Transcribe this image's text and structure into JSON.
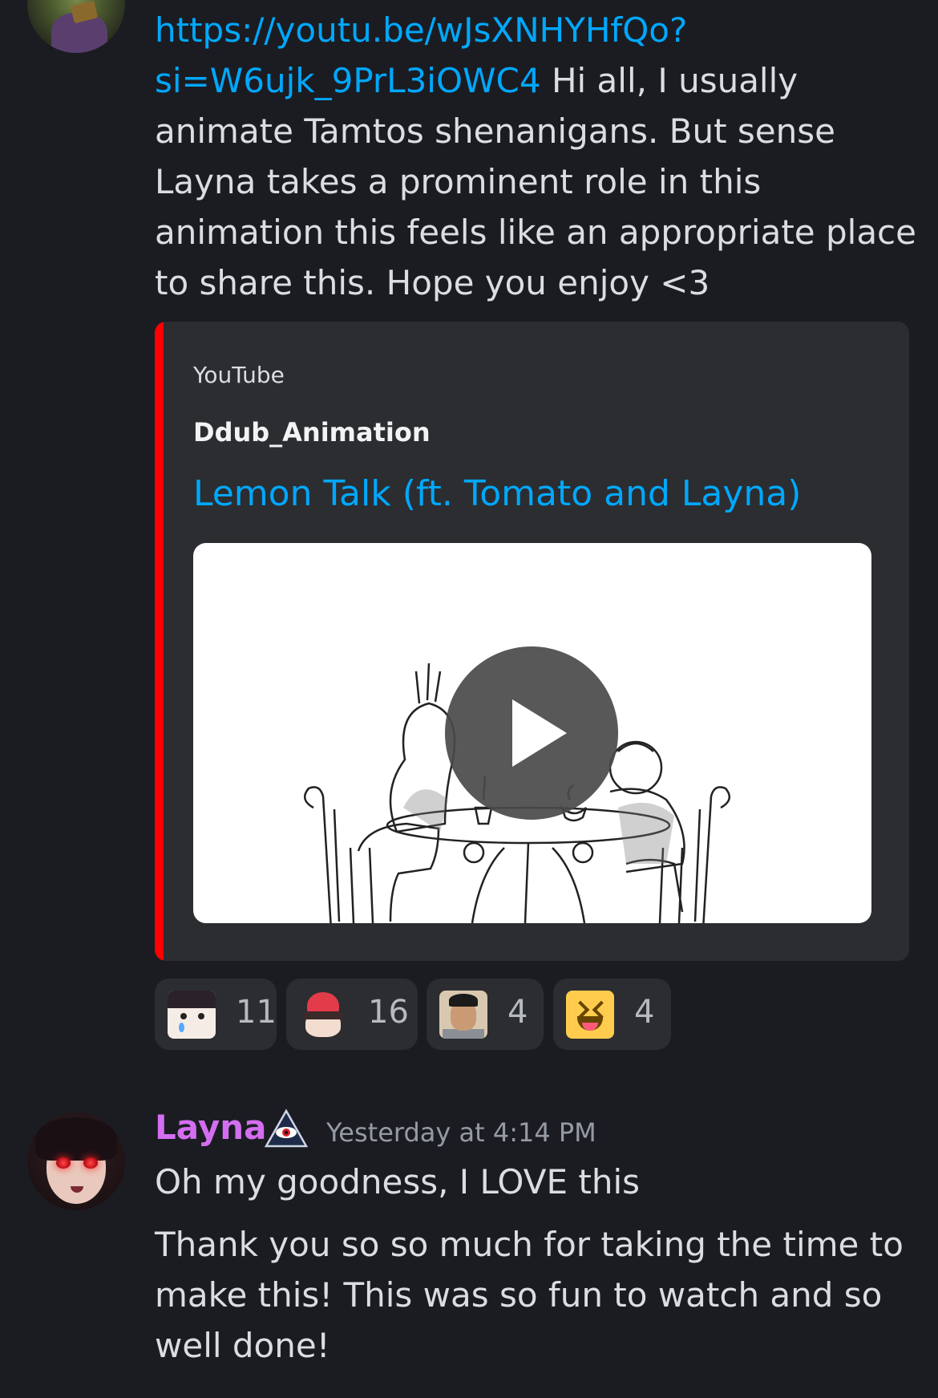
{
  "messages": [
    {
      "link": "https://youtu.be/wJsXNHYHfQo?si=W6ujk_9PrL3iOWC4",
      "link_line1": "https://youtu.be/wJsXNHYHfQo?",
      "link_line2": "si=W6ujk_9PrL3iOWC4",
      "text": " Hi all, I usually animate Tamtos shenanigans. But sense Layna takes a prominent role in this animation this feels like an appropriate place to share this. Hope you enjoy <3",
      "embed": {
        "provider": "YouTube",
        "author": "Ddub_Animation",
        "title": "Lemon Talk (ft. Tomato and Layna)",
        "accent_color": "#ff0000"
      },
      "reactions": [
        {
          "emoji": "crying-anime-emoji",
          "count": "11"
        },
        {
          "emoji": "heart-anime-emoji",
          "count": "16"
        },
        {
          "emoji": "surprised-man-emoji",
          "count": "4"
        },
        {
          "emoji": "laughing-emoji",
          "count": "4"
        }
      ]
    },
    {
      "author": "Layna",
      "author_color": "#d36ef0",
      "role_icon": "illuminati-eye-icon",
      "timestamp": "Yesterday at 4:14 PM",
      "lines": [
        "Oh my goodness, I LOVE this",
        "Thank you so so much for taking the time to make this! This was so fun to watch and so well done!"
      ]
    }
  ]
}
